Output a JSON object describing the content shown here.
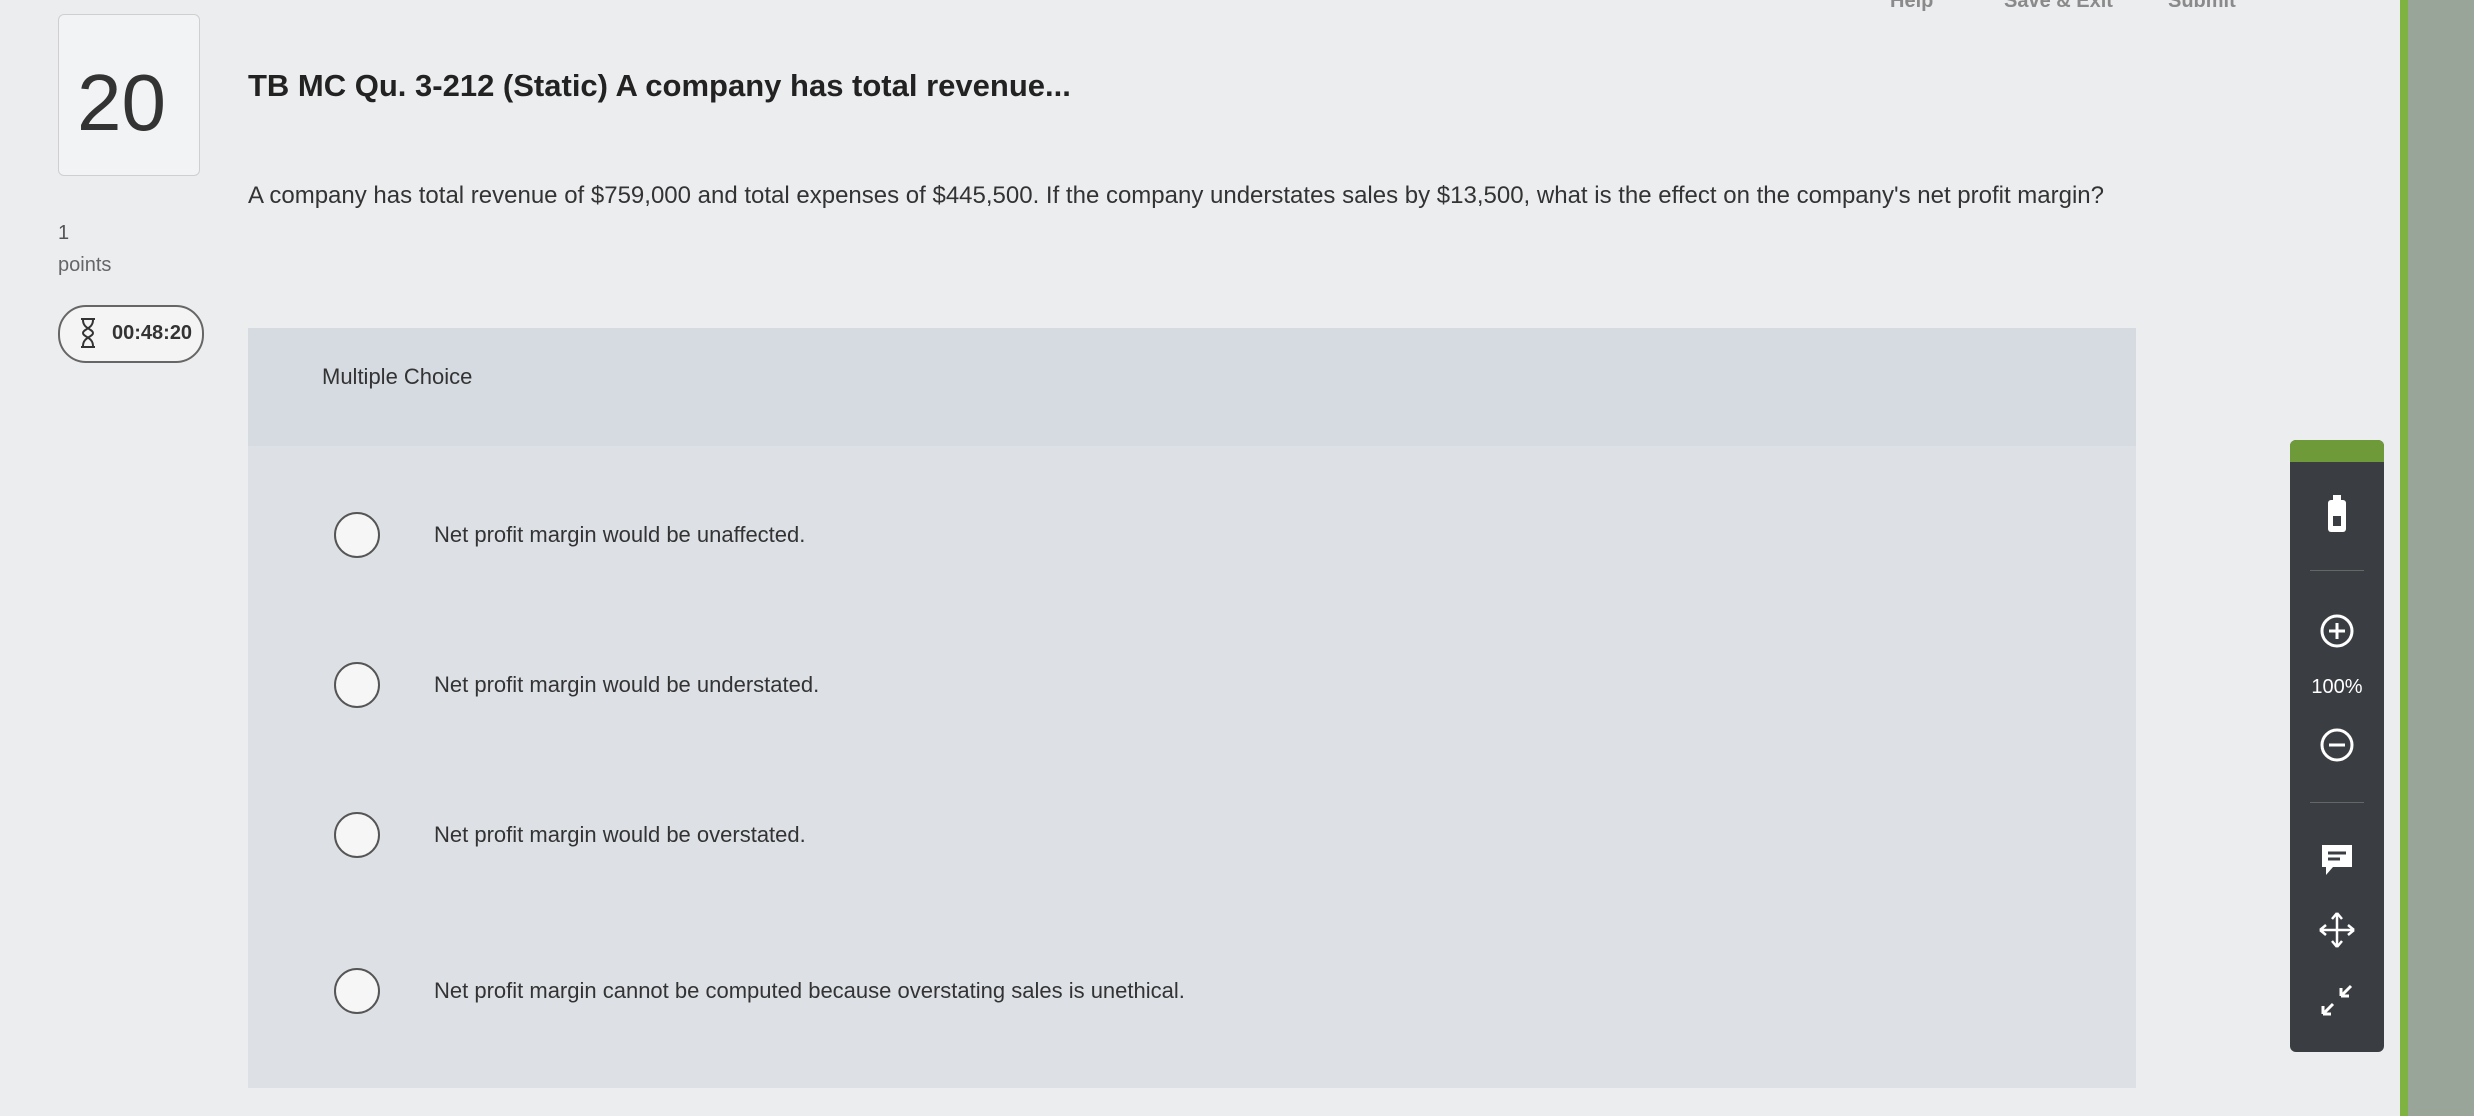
{
  "topbar": {
    "help": "Help",
    "save_exit": "Save & Exit",
    "submit": "Submit"
  },
  "question": {
    "number": "20",
    "points_value": "1",
    "points_label": "points",
    "timer": "00:48:20",
    "title": "TB MC Qu. 3-212 (Static) A company has total revenue...",
    "text": "A company has total revenue of $759,000 and total expenses of $445,500. If the company understates sales by $13,500, what is the effect on the company's net profit margin?"
  },
  "multiple_choice": {
    "label": "Multiple Choice",
    "options": [
      "Net profit margin would be unaffected.",
      "Net profit margin would be understated.",
      "Net profit margin would be overstated.",
      "Net profit margin cannot be computed because overstating sales is unethical."
    ]
  },
  "toolbar": {
    "zoom": "100%"
  },
  "icons": [
    "hourglass-icon",
    "battery-icon",
    "zoom-in-icon",
    "zoom-out-icon",
    "comment-icon",
    "move-icon",
    "expand-icon"
  ],
  "colors": {
    "accent_green": "#7fb341",
    "toolbar_bg": "#3a3d42"
  }
}
